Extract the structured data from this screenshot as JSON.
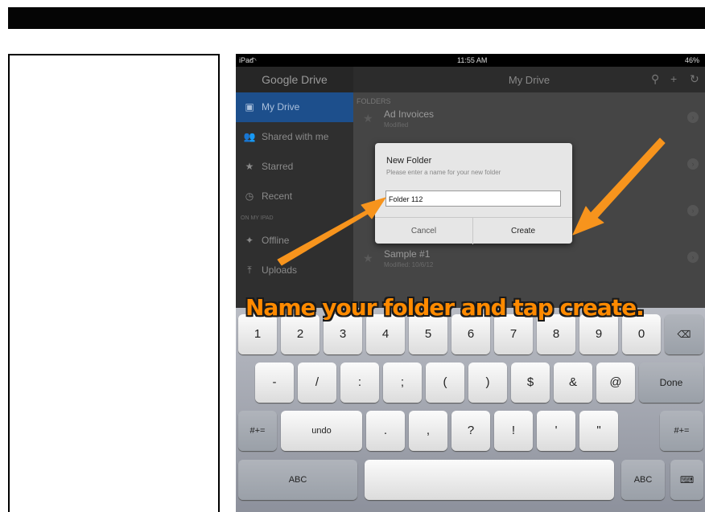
{
  "status": {
    "device": "iPad",
    "time": "11:55 AM",
    "battery": "46%"
  },
  "sidebar": {
    "app_title": "Google Drive",
    "items": [
      {
        "label": "My Drive",
        "icon": "drive-icon",
        "glyph": "▣"
      },
      {
        "label": "Shared with me",
        "icon": "people-icon",
        "glyph": "👥"
      },
      {
        "label": "Starred",
        "icon": "star-icon",
        "glyph": "★"
      },
      {
        "label": "Recent",
        "icon": "clock-icon",
        "glyph": "◷"
      }
    ],
    "section_label": "ON MY IPAD",
    "ipad_items": [
      {
        "label": "Offline",
        "icon": "pin-icon",
        "glyph": "✦"
      },
      {
        "label": "Uploads",
        "icon": "upload-icon",
        "glyph": "⤒"
      }
    ]
  },
  "main": {
    "title": "My Drive",
    "folders_label": "FOLDERS",
    "folders": [
      {
        "name": "Ad Invoices",
        "meta": "Modified"
      },
      {
        "name": "",
        "meta": ""
      },
      {
        "name": "",
        "meta": ""
      },
      {
        "name": "Sample #1",
        "meta": "Modified: 10/6/12"
      }
    ]
  },
  "dialog": {
    "title": "New Folder",
    "subtitle": "Please enter a name for your new folder",
    "input_value": "Folder 112",
    "cancel_label": "Cancel",
    "create_label": "Create"
  },
  "caption": "Name your folder and tap create.",
  "keyboard": {
    "row1": [
      "1",
      "2",
      "3",
      "4",
      "5",
      "6",
      "7",
      "8",
      "9",
      "0"
    ],
    "row2": [
      "-",
      "/",
      ":",
      ";",
      "(",
      ")",
      "$",
      "&",
      "@"
    ],
    "done_label": "Done",
    "row3_left": "#+=",
    "undo_label": "undo",
    "row3": [
      ".",
      ",",
      "?",
      "!",
      "'",
      "\""
    ],
    "row3_right": "#+=",
    "abc_left": "ABC",
    "abc_right": "ABC"
  },
  "colors": {
    "caption": "#ff8a00",
    "arrow": "#f7941d",
    "active_item": "#1d4f8c"
  }
}
